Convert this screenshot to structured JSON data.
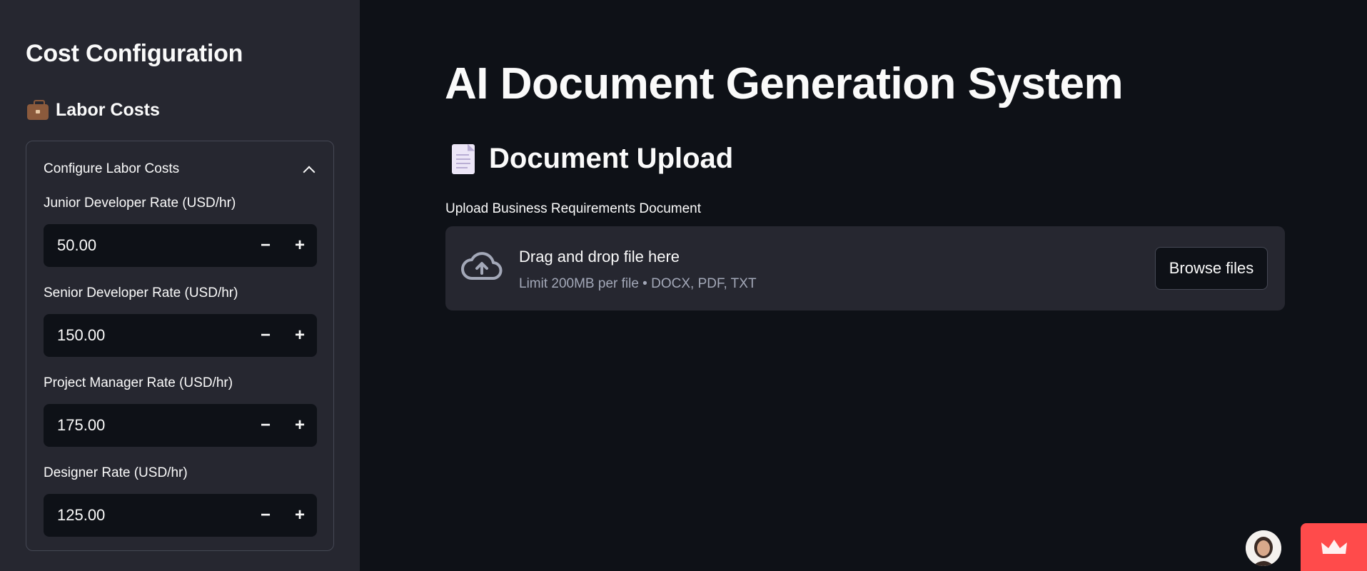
{
  "sidebar": {
    "title": "Cost Configuration",
    "section_title": "Labor Costs",
    "section_icon": "briefcase-icon",
    "expander": {
      "label": "Configure Labor Costs",
      "expanded": true,
      "fields": [
        {
          "label": "Junior Developer Rate (USD/hr)",
          "value": "50.00"
        },
        {
          "label": "Senior Developer Rate (USD/hr)",
          "value": "150.00"
        },
        {
          "label": "Project Manager Rate (USD/hr)",
          "value": "175.00"
        },
        {
          "label": "Designer Rate (USD/hr)",
          "value": "125.00"
        }
      ],
      "decrement_symbol": "−",
      "increment_symbol": "+"
    }
  },
  "main": {
    "title": "AI Document Generation System",
    "section_title": "Document Upload",
    "section_icon": "document-icon",
    "uploader": {
      "label": "Upload Business Requirements Document",
      "drop_text": "Drag and drop file here",
      "limit_text": "Limit 200MB per file • DOCX, PDF, TXT",
      "browse_label": "Browse files",
      "icon": "cloud-upload-icon"
    }
  },
  "colors": {
    "background": "#0e1117",
    "sidebar": "#262730",
    "accent": "#ff4b4b",
    "text": "#fafafa",
    "muted": "#a3a8b8"
  }
}
